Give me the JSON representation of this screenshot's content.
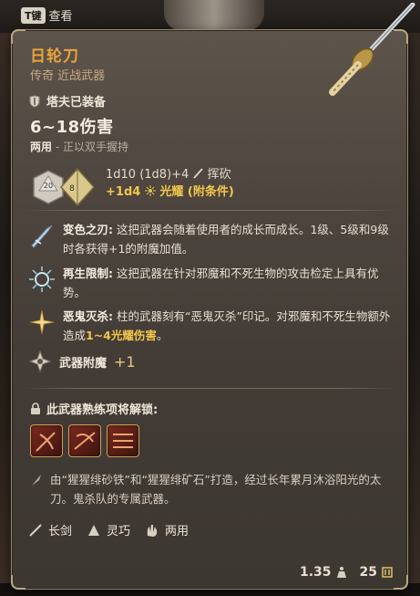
{
  "hotkey": {
    "key": "T键",
    "label": "查看"
  },
  "item": {
    "name": "日轮刀",
    "rarity_type": "传奇 近战武器",
    "equipped_by": "塔夫已装备",
    "damage": "6~18伤害",
    "handed_main": "两用",
    "handed_note": " - 正以双手握持",
    "formula": "1d10 (1d8)+4",
    "damage_type": "挥砍",
    "extra_damage": "+1d4",
    "extra_type": "光耀 (附条件)",
    "dice_labels": [
      "20",
      "8"
    ]
  },
  "features": [
    {
      "name": "变色之刃:",
      "text": " 这把武器会随着使用者的成长而成长。1级、5级和9级时各获得+1的附魔加值。",
      "highlight": "",
      "tail": ""
    },
    {
      "name": "再生限制:",
      "text": " 这把武器在针对邪魔和不死生物的攻击检定上具有优势。",
      "highlight": "",
      "tail": ""
    },
    {
      "name": "恶鬼灭杀:",
      "text": " 柱的武器刻有“恶鬼灭杀”印记。对邪魔和不死生物额外造成",
      "highlight": "1~4光耀伤害",
      "tail": "。"
    }
  ],
  "enchant": {
    "label": "武器附魔",
    "value": "+1"
  },
  "mastery": {
    "title": "此武器熟练项将解锁:",
    "count": 3
  },
  "lore": "由“猩猩绯砂铁”和“猩猩绯矿石”打造，经过长年累月沐浴阳光的太刀。鬼杀队的专属武器。",
  "properties": [
    {
      "icon": "longsword-icon",
      "label": "长剑"
    },
    {
      "icon": "finesse-icon",
      "label": "灵巧"
    },
    {
      "icon": "versatile-icon",
      "label": "两用"
    }
  ],
  "footer": {
    "weight": "1.35",
    "price": "25"
  },
  "colors": {
    "name": "#e9a33a",
    "highlight": "#f1c64c",
    "border": "#9a8a6c"
  }
}
